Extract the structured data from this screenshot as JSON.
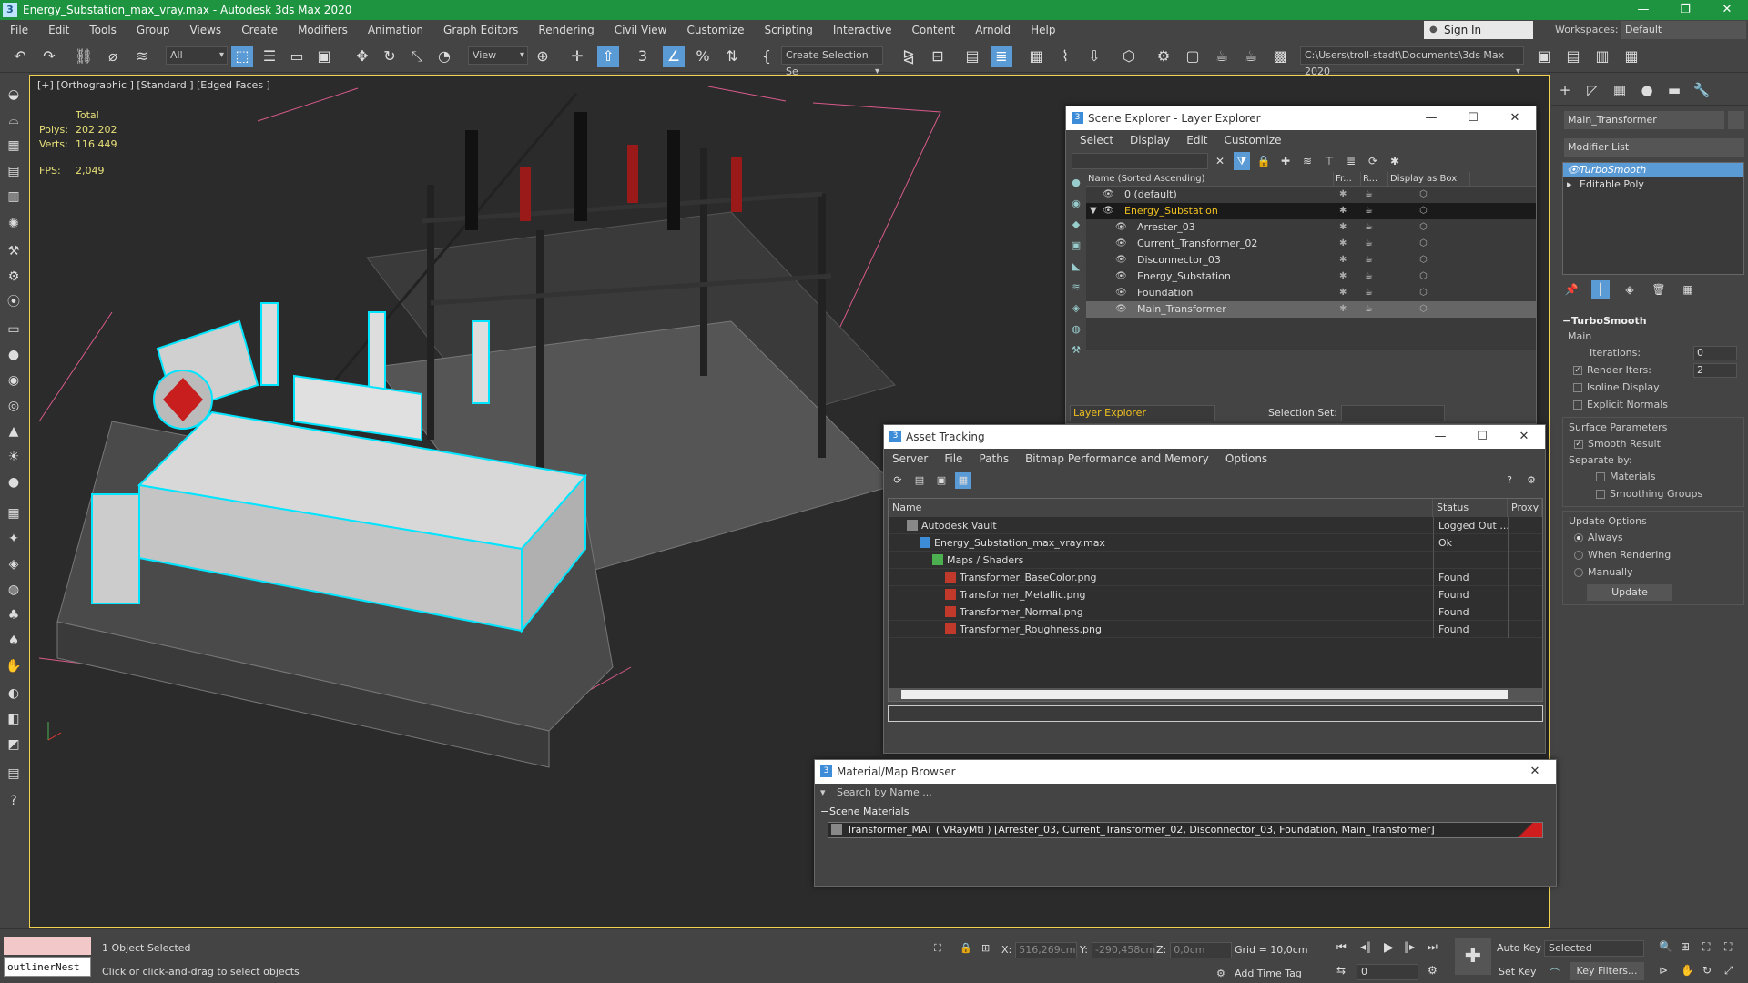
{
  "app": {
    "title": "Energy_Substation_max_vray.max - Autodesk 3ds Max 2020",
    "icon": "3"
  },
  "menu": [
    "File",
    "Edit",
    "Tools",
    "Group",
    "Views",
    "Create",
    "Modifiers",
    "Animation",
    "Graph Editors",
    "Rendering",
    "Civil View",
    "Customize",
    "Scripting",
    "Interactive",
    "Content",
    "Arnold",
    "Help"
  ],
  "signin": "Sign In",
  "workspaces": {
    "label": "Workspaces:",
    "value": "Default"
  },
  "toolbar": {
    "filter": "All",
    "view": "View",
    "selection_set": "Create Selection Se",
    "path": "C:\\Users\\troll-stadt\\Documents\\3ds Max 2020"
  },
  "viewport": {
    "label": "[+] [Orthographic ] [Standard ] [Edged Faces ]",
    "stats": {
      "total_label": "Total",
      "polys_label": "Polys:",
      "polys": "202 202",
      "verts_label": "Verts:",
      "verts": "116 449",
      "fps_label": "FPS:",
      "fps": "2,049"
    }
  },
  "command_panel": {
    "object_name": "Main_Transformer",
    "modifier_list": "Modifier List",
    "stack": [
      "TurboSmooth",
      "Editable Poly"
    ],
    "rollout": {
      "title": "TurboSmooth",
      "main": "Main",
      "iterations_label": "Iterations:",
      "iterations": "0",
      "render_iters_label": "Render Iters:",
      "render_iters": "2",
      "isoline": "Isoline Display",
      "explicit_normals": "Explicit Normals",
      "surface_params": "Surface Parameters",
      "smooth_result": "Smooth Result",
      "separate_by": "Separate by:",
      "materials": "Materials",
      "smoothing_groups": "Smoothing Groups",
      "update_options": "Update Options",
      "always": "Always",
      "when_rendering": "When Rendering",
      "manually": "Manually",
      "update": "Update"
    }
  },
  "scene_explorer": {
    "title": "Scene Explorer - Layer Explorer",
    "menu": [
      "Select",
      "Display",
      "Edit",
      "Customize"
    ],
    "columns": {
      "name": "Name (Sorted Ascending)",
      "fr": "Fr...",
      "r": "R...",
      "box": "Display as Box"
    },
    "rows": [
      {
        "name": "0 (default)",
        "level": 1
      },
      {
        "name": "Energy_Substation",
        "level": 1
      },
      {
        "name": "Arrester_03",
        "level": 2
      },
      {
        "name": "Current_Transformer_02",
        "level": 2
      },
      {
        "name": "Disconnector_03",
        "level": 2
      },
      {
        "name": "Energy_Substation",
        "level": 2
      },
      {
        "name": "Foundation",
        "level": 2
      },
      {
        "name": "Main_Transformer",
        "level": 2
      }
    ],
    "bottom": {
      "explorer": "Layer Explorer",
      "selection_set_label": "Selection Set:"
    }
  },
  "asset_tracking": {
    "title": "Asset Tracking",
    "menu": [
      "Server",
      "File",
      "Paths",
      "Bitmap Performance and Memory",
      "Options"
    ],
    "columns": {
      "name": "Name",
      "status": "Status",
      "proxy": "Proxy"
    },
    "rows": [
      {
        "name": "Autodesk Vault",
        "status": "Logged Out ...",
        "indent": 1
      },
      {
        "name": "Energy_Substation_max_vray.max",
        "status": "Ok",
        "indent": 2
      },
      {
        "name": "Maps / Shaders",
        "status": "",
        "indent": 3
      },
      {
        "name": "Transformer_BaseColor.png",
        "status": "Found",
        "indent": 4
      },
      {
        "name": "Transformer_Metallic.png",
        "status": "Found",
        "indent": 4
      },
      {
        "name": "Transformer_Normal.png",
        "status": "Found",
        "indent": 4
      },
      {
        "name": "Transformer_Roughness.png",
        "status": "Found",
        "indent": 4
      }
    ]
  },
  "material_browser": {
    "title": "Material/Map Browser",
    "search": "Search by Name ...",
    "group": "Scene Materials",
    "item": "Transformer_MAT  ( VRayMtl )  [Arrester_03, Current_Transformer_02, Disconnector_03, Foundation, Main_Transformer]"
  },
  "status": {
    "selected": "1 Object Selected",
    "hint": "Click or click-and-drag to select objects",
    "maxscript": "outlinerNest",
    "x_label": "X:",
    "x": "516,269cm",
    "y_label": "Y:",
    "y": "-290,458cm",
    "z_label": "Z:",
    "z": "0,0cm",
    "grid": "Grid = 10,0cm",
    "add_time_tag": "Add Time Tag",
    "frame": "0",
    "auto_key": "Auto Key",
    "set_key": "Set Key",
    "selected_dd": "Selected",
    "key_filters": "Key Filters..."
  },
  "colors": {
    "title_bar": "#1e9440",
    "selection": "#5b9bd5",
    "wire_select": "#00e5ff",
    "stats": "#e8e079",
    "accent_red": "#d01e1e"
  }
}
